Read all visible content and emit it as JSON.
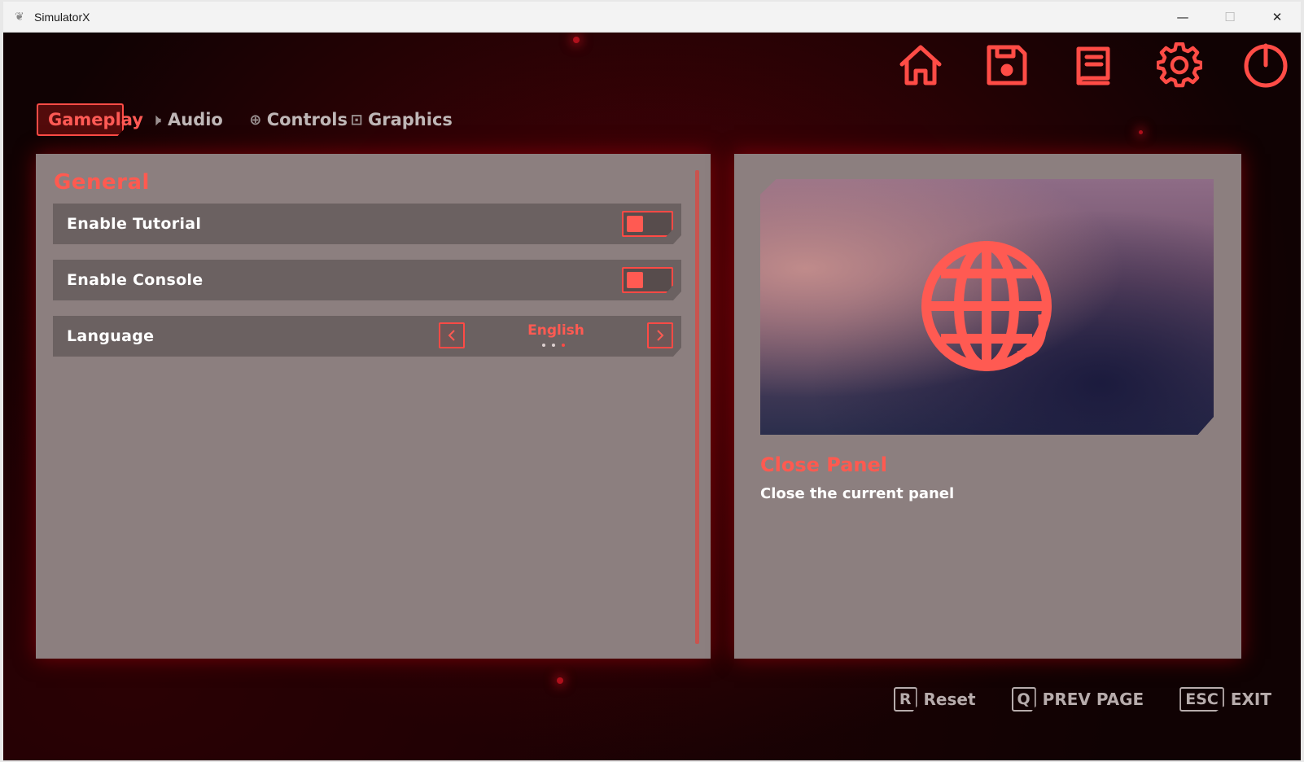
{
  "window": {
    "title": "SimulatorX",
    "controls": {
      "minimize": "—",
      "maximize": "☐",
      "close": "✕"
    }
  },
  "topnav": [
    {
      "icon": "home-icon"
    },
    {
      "icon": "save-icon"
    },
    {
      "icon": "book-icon"
    },
    {
      "icon": "gear-icon"
    },
    {
      "icon": "power-icon"
    }
  ],
  "tabs": [
    {
      "label": "Gameplay",
      "icon": "gameplay-icon",
      "active": true
    },
    {
      "label": "Audio",
      "icon": "speaker-icon",
      "active": false
    },
    {
      "label": "Controls",
      "icon": "controller-icon",
      "active": false
    },
    {
      "label": "Graphics",
      "icon": "display-icon",
      "active": false
    }
  ],
  "settings": {
    "section_title": "General",
    "rows": [
      {
        "label": "Enable Tutorial",
        "type": "toggle",
        "value": false
      },
      {
        "label": "Enable Console",
        "type": "toggle",
        "value": false
      },
      {
        "label": "Language",
        "type": "selector",
        "value": "English",
        "option_count": 3,
        "selected_index": 2
      }
    ]
  },
  "info": {
    "title": "Close Panel",
    "description": "Close the current panel",
    "preview_icon": "globe-icon"
  },
  "hints": [
    {
      "key": "R",
      "label": "Reset"
    },
    {
      "key": "Q",
      "label": "PREV PAGE"
    },
    {
      "key": "ESC",
      "label": "EXIT"
    }
  ],
  "colors": {
    "accent": "#ff5a52",
    "panel": "#8c7f7f",
    "row": "#6b6161",
    "background": "#100203"
  }
}
